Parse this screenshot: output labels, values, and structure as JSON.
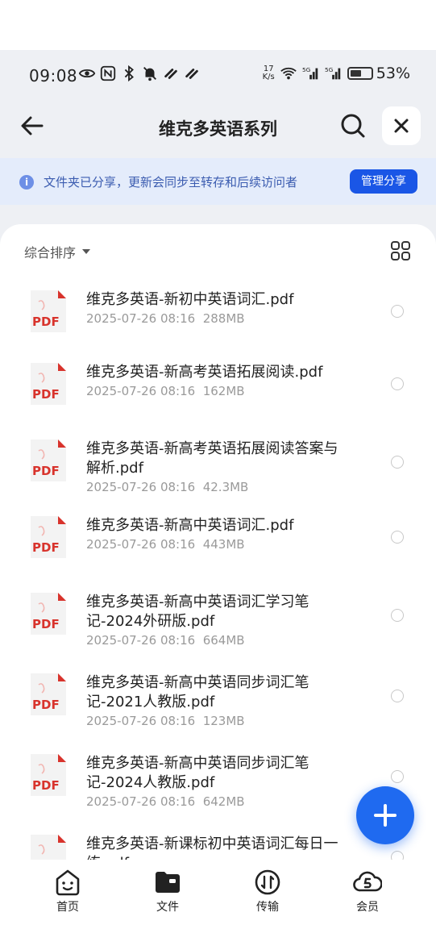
{
  "status_bar": {
    "time": "09:08",
    "speed_top": "17",
    "speed_bottom": "K/s",
    "battery_pct": "53%",
    "battery_level": 0.53
  },
  "header": {
    "title": "维克多英语系列"
  },
  "notice": {
    "text": "文件夹已分享，更新会同步至转存和后续访问者",
    "button": "管理分享"
  },
  "list": {
    "sort_label": "综合排序",
    "files": [
      {
        "name": "维克多英语-新初中英语词汇.pdf",
        "date": "2025-07-26 08:16",
        "size": "288MB",
        "icon_label": "PDF"
      },
      {
        "name": "维克多英语-新高考英语拓展阅读.pdf",
        "date": "2025-07-26 08:16",
        "size": "162MB",
        "icon_label": "PDF"
      },
      {
        "name": "维克多英语-新高考英语拓展阅读答案与解析.pdf",
        "date": "2025-07-26 08:16",
        "size": "42.3MB",
        "icon_label": "PDF"
      },
      {
        "name": "维克多英语-新高中英语词汇.pdf",
        "date": "2025-07-26 08:16",
        "size": "443MB",
        "icon_label": "PDF"
      },
      {
        "name": "维克多英语-新高中英语词汇学习笔记-2024外研版.pdf",
        "date": "2025-07-26 08:16",
        "size": "664MB",
        "icon_label": "PDF"
      },
      {
        "name": "维克多英语-新高中英语同步词汇笔记-2021人教版.pdf",
        "date": "2025-07-26 08:16",
        "size": "123MB",
        "icon_label": "PDF"
      },
      {
        "name": "维克多英语-新高中英语同步词汇笔记-2024人教版.pdf",
        "date": "2025-07-26 08:16",
        "size": "642MB",
        "icon_label": "PDF"
      },
      {
        "name": "维克多英语-新课标初中英语词汇每日一练.pdf",
        "date": "",
        "size": "",
        "icon_label": "PDF"
      }
    ]
  },
  "bottom_nav": {
    "items": [
      {
        "label": "首页",
        "icon": "home-face-icon"
      },
      {
        "label": "文件",
        "icon": "folder-icon"
      },
      {
        "label": "传输",
        "icon": "transfer-icon"
      },
      {
        "label": "会员",
        "icon": "vip-cloud-icon"
      }
    ]
  },
  "colors": {
    "accent": "#1a56e6",
    "notice_bg": "#e4ecfb",
    "pdf_red": "#d8332c"
  }
}
